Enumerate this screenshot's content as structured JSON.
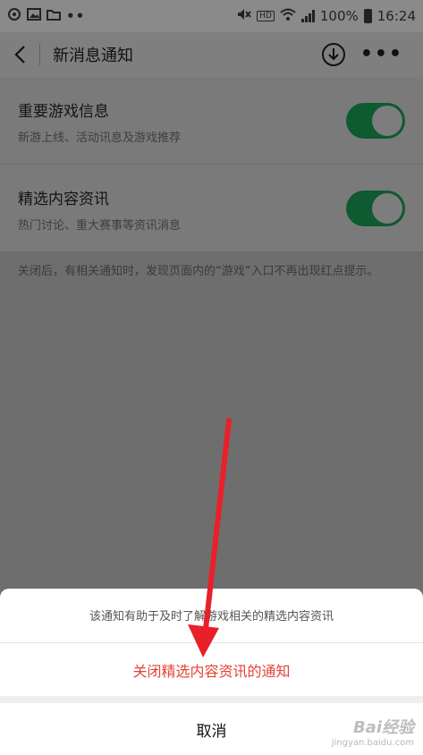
{
  "status_bar": {
    "battery": "100%",
    "time": "16:24",
    "hd_badge": "HD",
    "dots": "••"
  },
  "header": {
    "title": "新消息通知"
  },
  "settings": [
    {
      "title": "重要游戏信息",
      "description": "新游上线、活动讯息及游戏推荐",
      "enabled": true
    },
    {
      "title": "精选内容资讯",
      "description": "热门讨论、重大赛事等资讯消息",
      "enabled": true
    }
  ],
  "notice": "关闭后，有相关通知时，发现页面内的“游戏”入口不再出现红点提示。",
  "sheet": {
    "message": "该通知有助于及时了解游戏相关的精选内容资讯",
    "action_label": "关闭精选内容资讯的通知",
    "cancel_label": "取消"
  },
  "watermark": {
    "main": "Bai经验",
    "sub": "jingyan.baidu.com"
  },
  "colors": {
    "toggle_on": "#0e5a31",
    "action_red": "#e44236",
    "arrow_red": "#e8202a"
  }
}
